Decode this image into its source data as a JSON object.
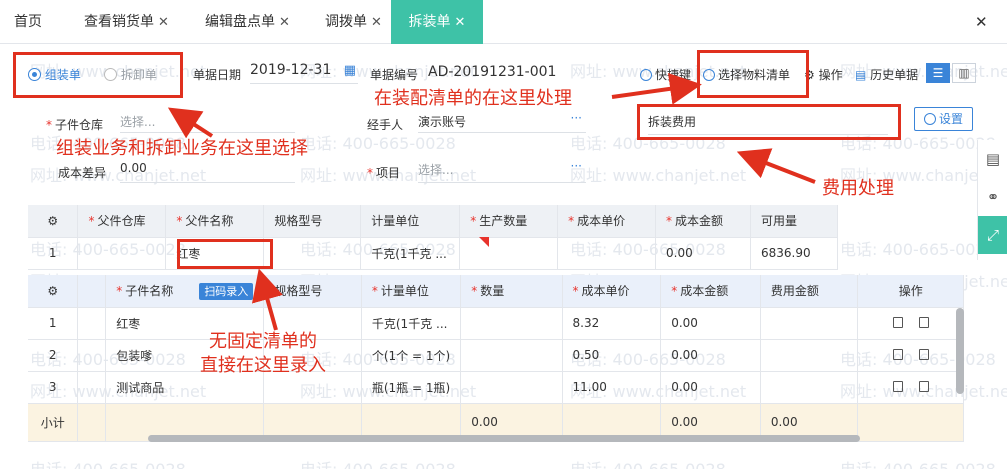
{
  "tabs": [
    {
      "label": "首页",
      "closable": false
    },
    {
      "label": "查看销货单",
      "closable": true
    },
    {
      "label": "编辑盘点单",
      "closable": true
    },
    {
      "label": "调拨单",
      "closable": true
    },
    {
      "label": "拆装单",
      "closable": true,
      "active": true
    }
  ],
  "close_glyph": "✕",
  "watermark": {
    "phone": "电话: 400-665-0028",
    "site": "网址: www.chanjet.net"
  },
  "form": {
    "radio_assemble": "组装单",
    "radio_disassemble": "拆卸单",
    "date_label": "单据日期",
    "date_value": "2019-12-31",
    "docno_label": "单据编号",
    "docno_value": "AD-20191231-001",
    "shortcut_label": "快捷键",
    "select_bom_label": "选择物料清单",
    "operate_label": "操作",
    "history_label": "历史单据",
    "sub_warehouse_label": "子件仓库",
    "sub_warehouse_placeholder": "选择...",
    "handler_label": "经手人",
    "handler_value": "演示账号",
    "fee_value": "拆装费用",
    "settings_label": "设置",
    "cost_diff_label": "成本差异",
    "cost_diff_value": "0.00",
    "project_label": "项目",
    "project_placeholder": "选择...",
    "ellipsis": "···"
  },
  "parent_table": {
    "headers": [
      "父件仓库",
      "父件名称",
      "规格型号",
      "计量单位",
      "生产数量",
      "成本单价",
      "成本金额",
      "可用量"
    ],
    "required": [
      true,
      true,
      false,
      false,
      true,
      true,
      true,
      false
    ],
    "rows": [
      {
        "no": "1",
        "warehouse": "",
        "name": "红枣",
        "spec": "",
        "unit": "千克(1千克 ...",
        "qty": "",
        "price": "",
        "amount": "0.00",
        "available": "6836.90"
      }
    ]
  },
  "child_table": {
    "headers": [
      "子件名称",
      "规格型号",
      "计量单位",
      "数量",
      "成本单价",
      "成本金额",
      "费用金额",
      "操作"
    ],
    "required": [
      true,
      false,
      true,
      true,
      true,
      true,
      false,
      false
    ],
    "scan_label": "扫码录入",
    "rows": [
      {
        "no": "1",
        "name": "红枣",
        "spec": "",
        "unit": "千克(1千克 ...",
        "qty": "",
        "price": "8.32",
        "amount": "0.00",
        "fee": ""
      },
      {
        "no": "2",
        "name": "包装嗲",
        "spec": "",
        "unit": "个(1个 = 1个)",
        "qty": "",
        "price": "0.50",
        "amount": "0.00",
        "fee": ""
      },
      {
        "no": "3",
        "name": "测试商品",
        "spec": "",
        "unit": "瓶(1瓶 = 1瓶)",
        "qty": "",
        "price": "11.00",
        "amount": "0.00",
        "fee": ""
      }
    ],
    "subtotal_label": "小计",
    "subtotal_qty": "0.00",
    "subtotal_amount": "0.00",
    "subtotal_fee": "0.00"
  },
  "annotations": {
    "a1": "组装业务和拆卸业务在这里选择",
    "a2": "在装配清单的在这里处理",
    "a3": "费用处理",
    "a4_line1": "无固定清单的",
    "a4_line2": "直接在这里录入"
  },
  "colors": {
    "accent": "#3ec2a7",
    "blue": "#3a84d8",
    "annotation_red": "#e0301e"
  }
}
